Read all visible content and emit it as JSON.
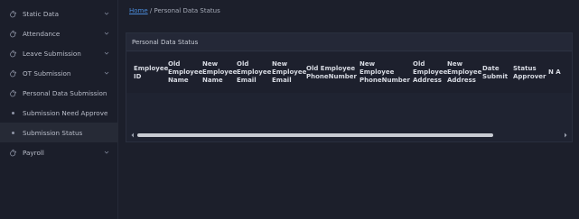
{
  "sidebar": {
    "items": [
      {
        "label": "Static Data",
        "icon": "hand-icon",
        "has_chevron": true,
        "active": false
      },
      {
        "label": "Attendance",
        "icon": "hand-icon",
        "has_chevron": true,
        "active": false
      },
      {
        "label": "Leave Submission",
        "icon": "hand-icon",
        "has_chevron": true,
        "active": false
      },
      {
        "label": "OT Submission",
        "icon": "hand-icon",
        "has_chevron": true,
        "active": false
      },
      {
        "label": "Personal Data Submission",
        "icon": "hand-icon",
        "has_chevron": false,
        "active": false
      },
      {
        "label": "Submission Need Approve",
        "icon": "bullet-icon",
        "has_chevron": false,
        "active": false
      },
      {
        "label": "Submission Status",
        "icon": "bullet-icon",
        "has_chevron": false,
        "active": true
      },
      {
        "label": "Payroll",
        "icon": "hand-icon",
        "has_chevron": true,
        "active": false
      }
    ]
  },
  "breadcrumb": {
    "home": "Home",
    "separator": "/",
    "current": "Personal Data Status"
  },
  "card": {
    "title": "Personal Data Status"
  },
  "table": {
    "columns": [
      "Employee ID",
      "Old Employee Name",
      "New Employee Name",
      "Old Employee Email",
      "New Employee Email",
      "Old Employee PhoneNumber",
      "New Employee PhoneNumber",
      "Old Employee Address",
      "New Employee Address",
      "Date Submit",
      "Status Approver",
      "N A"
    ]
  },
  "colors": {
    "accent_link": "#4a8ad8",
    "background": "#1c1f2b",
    "sidebar_active": "#262a36"
  }
}
